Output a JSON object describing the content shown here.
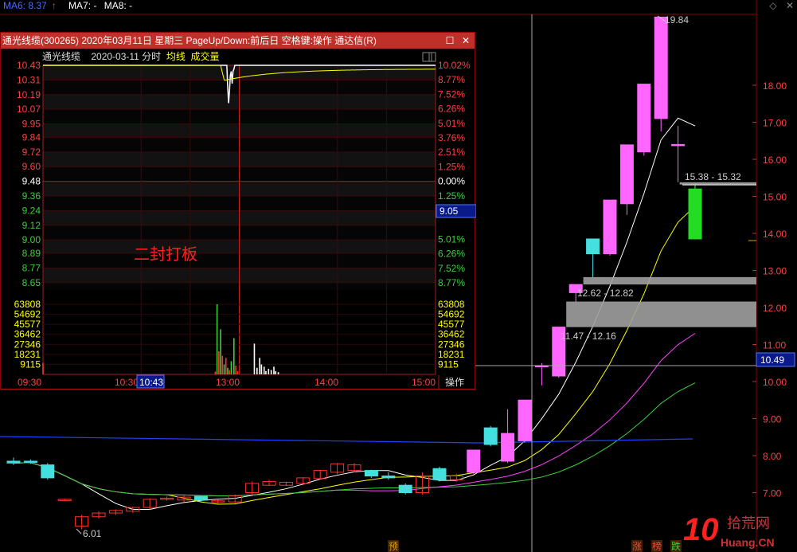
{
  "legend": [
    {
      "label": "MA6: 8.37",
      "arrow": "↑",
      "color": "#4a6cff"
    },
    {
      "label": "MA7: -",
      "color": "#ffffff"
    },
    {
      "label": "MA8: -",
      "color": "#ffffff"
    }
  ],
  "top_icons": [
    "diamond-icon",
    "close-icon"
  ],
  "popup": {
    "title": "通光线缆(300265) 2020年03月11日 星期三 PageUp/Down:前后日 空格键:操作 通达信(R)",
    "stock_name": "通光线缆",
    "date_label": "2020-03-11 分时",
    "avg_label": "均线",
    "vol_label": "成交量",
    "annotation": "二封打板",
    "op_button": "操作",
    "current_price_tag": "9.05",
    "cursor_time_tag": "10:43"
  },
  "chart_data": [
    {
      "type": "candlestick",
      "title": "",
      "ylim": [
        5.8,
        20.2
      ],
      "y_ticks": [
        "18.00",
        "17.00",
        "16.00",
        "15.00",
        "14.00",
        "13.00",
        "12.00",
        "11.00",
        "10.00",
        "9.00",
        "8.00",
        "7.00"
      ],
      "price_tag": "10.49",
      "candles": [
        {
          "o": 7.85,
          "h": 7.95,
          "l": 7.75,
          "c": 7.8
        },
        {
          "o": 7.85,
          "h": 7.9,
          "l": 7.78,
          "c": 7.82
        },
        {
          "o": 7.75,
          "h": 7.8,
          "l": 7.35,
          "c": 7.4
        },
        {
          "o": 6.82,
          "h": 6.84,
          "l": 6.8,
          "c": 6.82
        },
        {
          "o": 6.1,
          "h": 6.4,
          "l": 6.01,
          "c": 6.35
        },
        {
          "o": 6.35,
          "h": 6.5,
          "l": 6.3,
          "c": 6.45
        },
        {
          "o": 6.45,
          "h": 6.55,
          "l": 6.4,
          "c": 6.52
        },
        {
          "o": 6.5,
          "h": 6.62,
          "l": 6.45,
          "c": 6.6
        },
        {
          "o": 6.6,
          "h": 6.85,
          "l": 6.55,
          "c": 6.82
        },
        {
          "o": 6.82,
          "h": 6.9,
          "l": 6.78,
          "c": 6.85
        },
        {
          "o": 6.8,
          "h": 6.92,
          "l": 6.75,
          "c": 6.88
        },
        {
          "o": 6.9,
          "h": 6.92,
          "l": 6.75,
          "c": 6.8
        },
        {
          "o": 6.75,
          "h": 6.82,
          "l": 6.7,
          "c": 6.78
        },
        {
          "o": 6.75,
          "h": 6.95,
          "l": 6.72,
          "c": 6.92
        },
        {
          "o": 7.0,
          "h": 7.3,
          "l": 6.95,
          "c": 7.25
        },
        {
          "o": 7.2,
          "h": 7.35,
          "l": 7.18,
          "c": 7.3
        },
        {
          "o": 7.2,
          "h": 7.3,
          "l": 7.18,
          "c": 7.28
        },
        {
          "o": 7.25,
          "h": 7.42,
          "l": 7.2,
          "c": 7.4
        },
        {
          "o": 7.38,
          "h": 7.62,
          "l": 7.35,
          "c": 7.6
        },
        {
          "o": 7.55,
          "h": 7.8,
          "l": 7.5,
          "c": 7.78
        },
        {
          "o": 7.6,
          "h": 7.8,
          "l": 7.55,
          "c": 7.75
        },
        {
          "o": 7.6,
          "h": 7.62,
          "l": 7.4,
          "c": 7.45
        },
        {
          "o": 7.45,
          "h": 7.55,
          "l": 7.35,
          "c": 7.4
        },
        {
          "o": 7.2,
          "h": 7.25,
          "l": 6.95,
          "c": 7.0
        },
        {
          "o": 7.0,
          "h": 7.55,
          "l": 6.95,
          "c": 7.45
        },
        {
          "o": 7.65,
          "h": 7.7,
          "l": 7.3,
          "c": 7.35
        },
        {
          "o": 7.35,
          "h": 7.5,
          "l": 7.3,
          "c": 7.45
        },
        {
          "o": 7.55,
          "h": 8.15,
          "l": 7.5,
          "c": 8.15
        },
        {
          "o": 8.75,
          "h": 8.8,
          "l": 8.25,
          "c": 8.3
        },
        {
          "o": 7.85,
          "h": 9.25,
          "l": 7.8,
          "c": 8.6
        },
        {
          "o": 8.4,
          "h": 9.5,
          "l": 8.35,
          "c": 9.5
        },
        {
          "o": 10.43,
          "h": 10.5,
          "l": 9.9,
          "c": 10.43
        },
        {
          "o": 10.15,
          "h": 11.47,
          "l": 10.1,
          "c": 11.47
        },
        {
          "o": 12.4,
          "h": 12.62,
          "l": 12.15,
          "c": 12.62
        },
        {
          "o": 13.85,
          "h": 13.85,
          "l": 12.82,
          "c": 13.45
        },
        {
          "o": 13.45,
          "h": 14.9,
          "l": 13.4,
          "c": 14.9
        },
        {
          "o": 14.8,
          "h": 16.39,
          "l": 14.5,
          "c": 16.39
        },
        {
          "o": 16.2,
          "h": 18.03,
          "l": 16.1,
          "c": 18.03
        },
        {
          "o": 17.1,
          "h": 19.84,
          "l": 16.75,
          "c": 19.84
        },
        {
          "o": 16.4,
          "h": 16.9,
          "l": 15.38,
          "c": 16.4
        },
        {
          "o": 15.2,
          "h": 15.32,
          "l": 13.85,
          "c": 13.85
        }
      ],
      "annotations": [
        {
          "text": "19.84"
        },
        {
          "text": "15.38 - 15.32"
        },
        {
          "text": "12.62 - 12.82"
        },
        {
          "text": "11.47 - 12.16"
        },
        {
          "text": "6.01"
        }
      ],
      "gaps": [
        {
          "low": 12.62,
          "high": 12.82
        },
        {
          "low": 11.47,
          "high": 12.16
        },
        {
          "low": 15.32,
          "high": 15.38
        }
      ],
      "bottom_tags": [
        {
          "text": "预",
          "color": "#d4a017"
        },
        {
          "text": "涨",
          "color": "#ff4040"
        },
        {
          "text": "榜",
          "color": "#ff4040"
        },
        {
          "text": "跌",
          "color": "#3cd03c"
        }
      ]
    },
    {
      "type": "line",
      "title": "",
      "y_left_ticks": [
        "10.43",
        "10.31",
        "10.19",
        "10.07",
        "9.95",
        "9.84",
        "9.72",
        "9.60",
        "9.48",
        "9.36",
        "9.24",
        "9.12",
        "9.00",
        "8.89",
        "8.77",
        "8.65"
      ],
      "y_right_ticks": [
        "10.02%",
        "8.77%",
        "7.52%",
        "6.26%",
        "5.01%",
        "3.76%",
        "2.51%",
        "1.25%",
        "0.00%",
        "1.25%",
        "2.51%",
        "5.01%",
        "6.26%",
        "7.52%",
        "8.77%"
      ],
      "vol_left_ticks": [
        "63808",
        "54692",
        "45577",
        "36462",
        "27346",
        "18231",
        "9115"
      ],
      "vol_right_ticks": [
        "63808",
        "54692",
        "45577",
        "36462",
        "27346",
        "18231",
        "9115"
      ],
      "x_ticks": [
        "09:30",
        "10:30",
        "13:00",
        "14:00",
        "15:00"
      ],
      "prev_close": 9.48,
      "ylim": [
        8.59,
        10.43
      ],
      "price_series": [
        10.43,
        10.43,
        10.43,
        10.43,
        10.43,
        10.43,
        10.43,
        10.43,
        10.43,
        10.43,
        10.43,
        10.43,
        10.43,
        10.43,
        10.43,
        10.43,
        10.43,
        10.43,
        10.43,
        10.43,
        10.43,
        10.43,
        10.43,
        10.43,
        10.43,
        10.43,
        10.43,
        10.43,
        10.43,
        10.43,
        10.43,
        10.43,
        10.43,
        10.43,
        10.43,
        10.43,
        10.43,
        10.43,
        10.43,
        10.43,
        10.43,
        10.43,
        10.43,
        10.43,
        10.43,
        10.43,
        10.43,
        10.43,
        10.43,
        10.43,
        10.43,
        10.43,
        10.43,
        10.43,
        10.43,
        10.43,
        10.43,
        10.43,
        10.43,
        10.43,
        10.43,
        10.43,
        10.43,
        10.43,
        10.43,
        10.43,
        10.43,
        10.43,
        10.43,
        10.43,
        10.43,
        10.43,
        10.43,
        10.43,
        10.43,
        10.43,
        10.43,
        10.43,
        10.43,
        10.43,
        10.43,
        10.43,
        10.43,
        10.43,
        10.43,
        10.43,
        10.43,
        10.43,
        10.43,
        10.43,
        10.43,
        10.43,
        10.43,
        10.43,
        10.43,
        10.43,
        10.43,
        10.43,
        10.43,
        10.43,
        10.43,
        10.43,
        10.43,
        10.43,
        10.43,
        10.43,
        10.43,
        10.43,
        10.43,
        10.43,
        10.43,
        10.43,
        10.43,
        10.43,
        10.43,
        10.43,
        10.43,
        10.43,
        10.43,
        10.43,
        10.43,
        10.43,
        10.43,
        10.43,
        10.43,
        10.43,
        10.43,
        10.43,
        10.43,
        10.43,
        10.43,
        10.43,
        10.43,
        10.43,
        10.43,
        10.43,
        10.43,
        10.43,
        10.43,
        10.43,
        10.43,
        10.43,
        10.43,
        10.43,
        10.43,
        10.43,
        10.43,
        10.43,
        10.43,
        10.43,
        10.43,
        10.43,
        10.43,
        10.43,
        10.43,
        10.43,
        10.43,
        10.43,
        10.43,
        10.43,
        10.43,
        10.43,
        10.43,
        10.43,
        10.43,
        10.43,
        10.43,
        10.43,
        10.43,
        10.43,
        10.43,
        10.43,
        10.43,
        10.43,
        10.43,
        10.43,
        10.43,
        10.43,
        10.43,
        10.43,
        10.43,
        10.43,
        10.43,
        10.43,
        10.43,
        10.43,
        10.43,
        10.43,
        10.43,
        10.43,
        10.43,
        10.43,
        10.43,
        10.43,
        10.43,
        10.43,
        10.43,
        10.43,
        10.43,
        10.43,
        10.43,
        10.43,
        10.43,
        10.43,
        10.43,
        10.43,
        10.43,
        10.43,
        10.25,
        10.12,
        10.22,
        10.35,
        10.38,
        10.28,
        10.38,
        10.4,
        10.43,
        10.43,
        10.43,
        10.43,
        10.43,
        10.43,
        10.43,
        10.43,
        10.43,
        10.43,
        10.43,
        10.43,
        10.43,
        10.43,
        10.43,
        10.43,
        10.43,
        10.43,
        10.43,
        10.43,
        10.43,
        10.43,
        10.43,
        10.43,
        10.43,
        10.43,
        10.43,
        10.43,
        10.43,
        10.43,
        10.43,
        10.43,
        10.43,
        10.43,
        10.43,
        10.43,
        10.43,
        10.43,
        10.43,
        10.43,
        10.43,
        10.43,
        10.43,
        10.43,
        10.43,
        10.43,
        10.43,
        10.43,
        10.43,
        10.43,
        10.43,
        10.43,
        10.43,
        10.43,
        10.43,
        10.43,
        10.43,
        10.43,
        10.43,
        10.43,
        10.43,
        10.43,
        10.43,
        10.43,
        10.43,
        10.43,
        10.43,
        10.43,
        10.43,
        10.43,
        10.43,
        10.43,
        10.43,
        10.43,
        10.43,
        10.43,
        10.43,
        10.43,
        10.43,
        10.43,
        10.43,
        10.43,
        10.43,
        10.43,
        10.43,
        10.43,
        10.43,
        10.43,
        10.43,
        10.43,
        10.43,
        10.43,
        10.43,
        10.43,
        10.43,
        10.43,
        10.43,
        10.43,
        10.43,
        10.43,
        10.43,
        10.43,
        10.43,
        10.43,
        10.43,
        10.43,
        10.43,
        10.43,
        10.43,
        10.43,
        10.43,
        10.43,
        10.43,
        10.43,
        10.43,
        10.43,
        10.43,
        10.43,
        10.43,
        10.43,
        10.43,
        10.43,
        10.43,
        10.43,
        10.43,
        10.43,
        10.43,
        10.43,
        10.43,
        10.43,
        10.43,
        10.43,
        10.43,
        10.43,
        10.43,
        10.43,
        10.43,
        10.43,
        10.43,
        10.43,
        10.43,
        10.43,
        10.43,
        10.43,
        10.43,
        10.43,
        10.43,
        10.43,
        10.43,
        10.43,
        10.43,
        10.43,
        10.43,
        10.43,
        10.43,
        10.43,
        10.43,
        10.43,
        10.43,
        10.43,
        10.43,
        10.43,
        10.43,
        10.43,
        10.43,
        10.43,
        10.43,
        10.43,
        10.43,
        10.43,
        10.43,
        10.43,
        10.43,
        10.43,
        10.43,
        10.43,
        10.43,
        10.43,
        10.43,
        10.43,
        10.43,
        10.43,
        10.43,
        10.43,
        10.43,
        10.43,
        10.43,
        10.43,
        10.43,
        10.43,
        10.43,
        10.43,
        10.43,
        10.43,
        10.43,
        10.43,
        10.43,
        10.43,
        10.43,
        10.43,
        10.43,
        10.43,
        10.43,
        10.43,
        10.43,
        10.43,
        10.43,
        10.43,
        10.43,
        10.43,
        10.43,
        10.43,
        10.43,
        10.43,
        10.43,
        10.43,
        10.43,
        10.43,
        10.43,
        10.43,
        10.43,
        10.43,
        10.43,
        10.43,
        10.43,
        10.43,
        10.43
      ],
      "avg_series_note": "",
      "volume_bars": [
        {
          "t": 0,
          "v": 10500,
          "color": "#ff3030"
        },
        {
          "t": 194,
          "v": 2500,
          "color": "#ff3030"
        },
        {
          "t": 196,
          "v": 63808,
          "color": "#3cd03c"
        },
        {
          "t": 198,
          "v": 21000,
          "color": "#ff3030"
        },
        {
          "t": 200,
          "v": 41000,
          "color": "#3cd03c"
        },
        {
          "t": 202,
          "v": 17000,
          "color": "#ff3030"
        },
        {
          "t": 204,
          "v": 9000,
          "color": "#3cd03c"
        },
        {
          "t": 206,
          "v": 15000,
          "color": "#ff3030"
        },
        {
          "t": 208,
          "v": 6000,
          "color": "#3cd03c"
        },
        {
          "t": 210,
          "v": 4000,
          "color": "#ff3030"
        },
        {
          "t": 212,
          "v": 12000,
          "color": "#3cd03c"
        },
        {
          "t": 215,
          "v": 33000,
          "color": "#3cd03c"
        },
        {
          "t": 217,
          "v": 8000,
          "color": "#ff3030"
        },
        {
          "t": 219,
          "v": 3000,
          "color": "#ff3030"
        },
        {
          "t": 238,
          "v": 28000,
          "color": "#ffffff"
        },
        {
          "t": 241,
          "v": 6000,
          "color": "#ffffff"
        },
        {
          "t": 244,
          "v": 15000,
          "color": "#ffffff"
        },
        {
          "t": 246,
          "v": 9000,
          "color": "#ffffff"
        },
        {
          "t": 249,
          "v": 7000,
          "color": "#ffffff"
        },
        {
          "t": 251,
          "v": 3000,
          "color": "#ffffff"
        },
        {
          "t": 254,
          "v": 5000,
          "color": "#ffffff"
        },
        {
          "t": 257,
          "v": 4000,
          "color": "#ffffff"
        },
        {
          "t": 260,
          "v": 7000,
          "color": "#ffffff"
        },
        {
          "t": 262,
          "v": 3000,
          "color": "#ffffff"
        },
        {
          "t": 265,
          "v": 2000,
          "color": "#ffffff"
        }
      ]
    }
  ]
}
